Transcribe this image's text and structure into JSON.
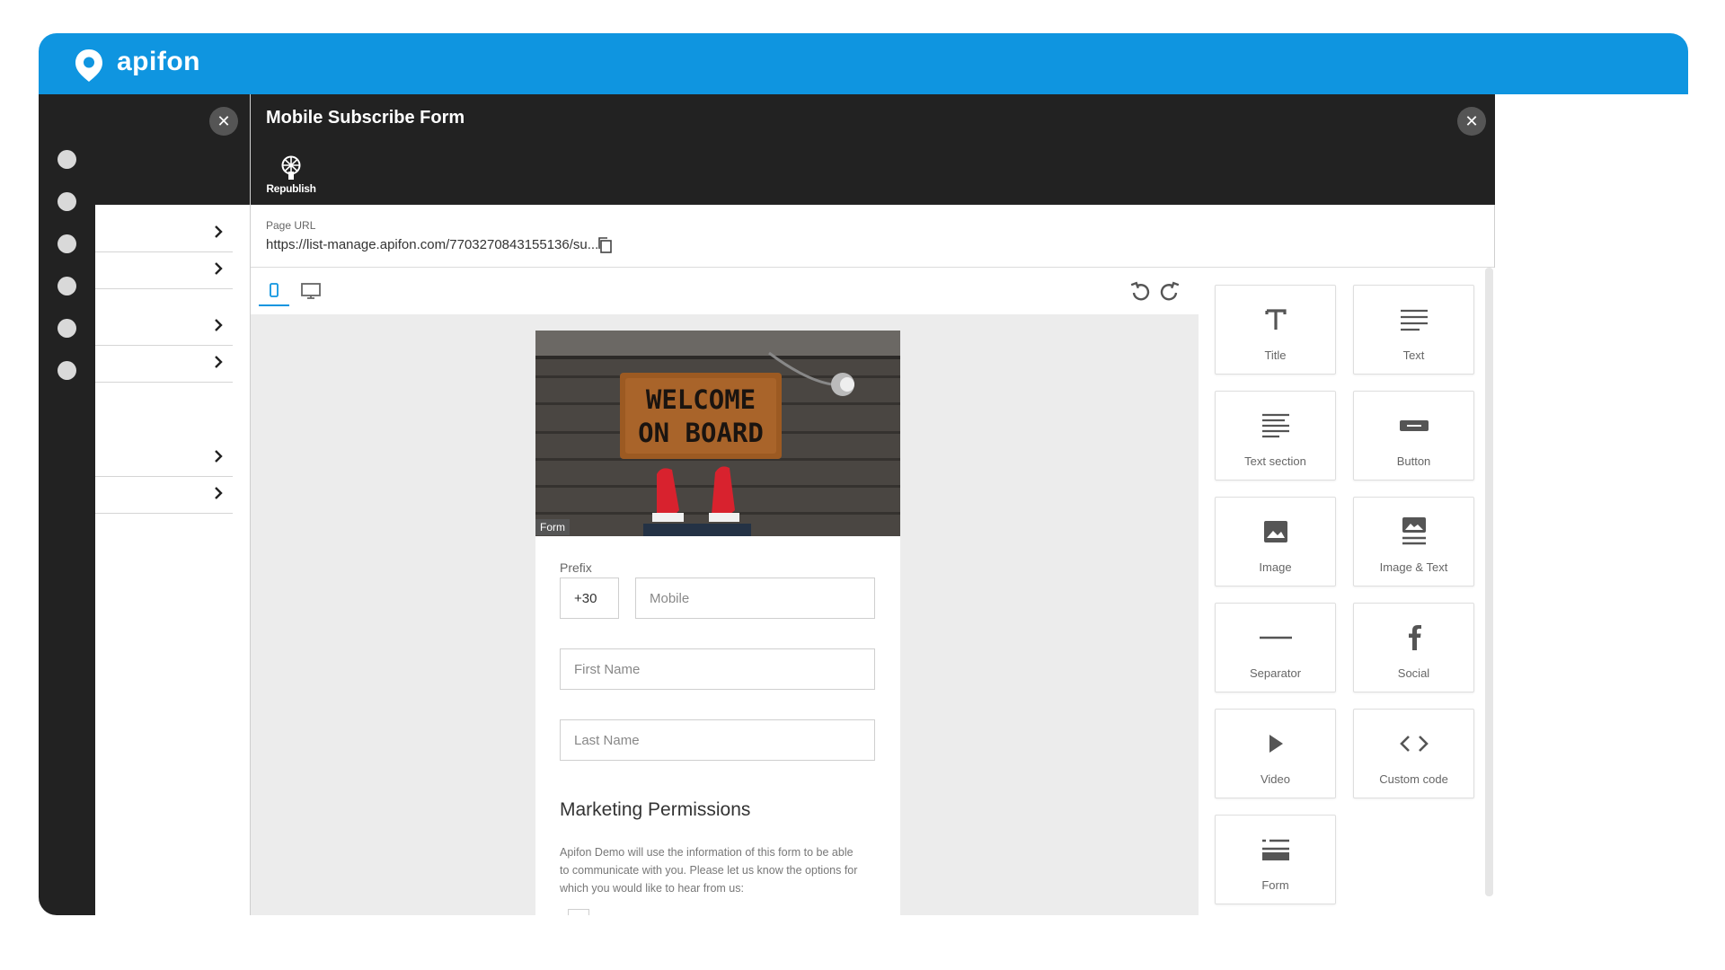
{
  "brand": {
    "name": "apifon",
    "color": "#0f95e0"
  },
  "rail": {
    "dots": 6
  },
  "drawer": {
    "close_icon": "close-icon",
    "rows": 6
  },
  "editor": {
    "title": "Mobile Subscribe Form",
    "republish_label": "Republish",
    "url_label": "Page URL",
    "url_value": "https://list-manage.apifon.com/7703270843155136/su..."
  },
  "preview": {
    "image_text": "WELCOME ON BOARD",
    "form_chip": "Form",
    "prefix_label": "Prefix",
    "prefix_value": "+30",
    "mobile_placeholder": "Mobile",
    "first_name_placeholder": "First Name",
    "last_name_placeholder": "Last Name",
    "permissions_title": "Marketing Permissions",
    "permissions_text": "Apifon Demo will use the information of this form to be able to communicate with you. Please let us know the options for which you would like to hear from us:"
  },
  "palette": {
    "blocks": [
      {
        "label": "Title",
        "icon": "title-icon"
      },
      {
        "label": "Text",
        "icon": "text-icon"
      },
      {
        "label": "Text section",
        "icon": "text-section-icon"
      },
      {
        "label": "Button",
        "icon": "button-icon"
      },
      {
        "label": "Image",
        "icon": "image-icon"
      },
      {
        "label": "Image & Text",
        "icon": "image-text-icon"
      },
      {
        "label": "Separator",
        "icon": "separator-icon"
      },
      {
        "label": "Social",
        "icon": "social-icon"
      },
      {
        "label": "Video",
        "icon": "video-icon"
      },
      {
        "label": "Custom code",
        "icon": "custom-code-icon"
      },
      {
        "label": "Form",
        "icon": "form-icon"
      }
    ]
  }
}
